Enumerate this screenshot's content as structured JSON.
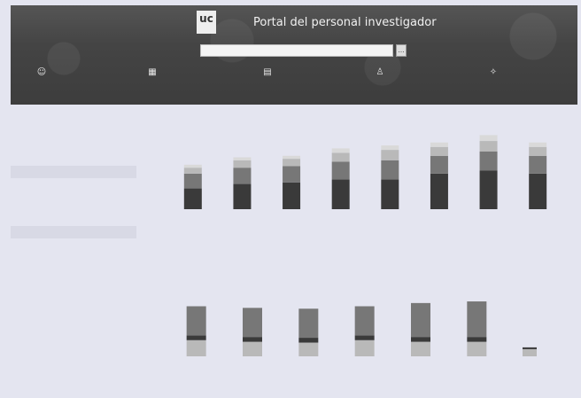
{
  "header": {
    "logo_text": "uc",
    "logo_sub": "",
    "title": "Portal del personal investigador",
    "search_value": "",
    "search_button": "…",
    "stats": [
      {
        "icon": "people-icon",
        "glyph": "☺",
        "num": "",
        "label": ""
      },
      {
        "icon": "building-icon",
        "glyph": "▦",
        "num": "",
        "label": ""
      },
      {
        "icon": "document-icon",
        "glyph": "▤",
        "num": "",
        "label": ""
      },
      {
        "icon": "person-icon",
        "glyph": "♙",
        "num": "",
        "label": ""
      },
      {
        "icon": "award-icon",
        "glyph": "✧",
        "num": "",
        "label": ""
      }
    ]
  },
  "colors": {
    "dark": "#3a3a3a",
    "mid": "#777777",
    "light": "#b9b9b9",
    "pale": "#d9d9d9",
    "bg": "#e4e5f0"
  },
  "chart_data": [
    {
      "type": "bar",
      "title": "",
      "categories": [
        "",
        "",
        "",
        "",
        "",
        "",
        "",
        ""
      ],
      "series": [
        {
          "values": [
            28,
            34,
            36,
            40,
            40,
            48,
            52,
            48
          ]
        },
        {
          "values": [
            20,
            22,
            22,
            24,
            26,
            24,
            26,
            24
          ]
        },
        {
          "values": [
            8,
            10,
            10,
            12,
            14,
            12,
            14,
            12
          ]
        },
        {
          "values": [
            4,
            4,
            4,
            6,
            6,
            6,
            8,
            6
          ]
        },
        {
          "values": [
            0,
            0,
            0,
            0,
            0,
            0,
            0,
            0
          ]
        },
        {
          "values": [
            0,
            0,
            0,
            0,
            0,
            0,
            0,
            0
          ]
        }
      ],
      "ylim": [
        0,
        110
      ]
    },
    {
      "type": "bar",
      "title": "",
      "categories": [
        "",
        "",
        "",
        "",
        "",
        ""
      ],
      "series": [
        {
          "values": [
            36,
            36,
            36,
            36,
            42,
            44
          ]
        },
        {
          "values": [
            6,
            6,
            6,
            6,
            6,
            6
          ]
        },
        {
          "values": [
            20,
            18,
            17,
            20,
            18,
            18
          ]
        },
        {
          "values": [
            0,
            0,
            0,
            0,
            0,
            0
          ]
        }
      ],
      "ylim": [
        0,
        90
      ],
      "extra_bar": {
        "value": 10
      }
    }
  ]
}
